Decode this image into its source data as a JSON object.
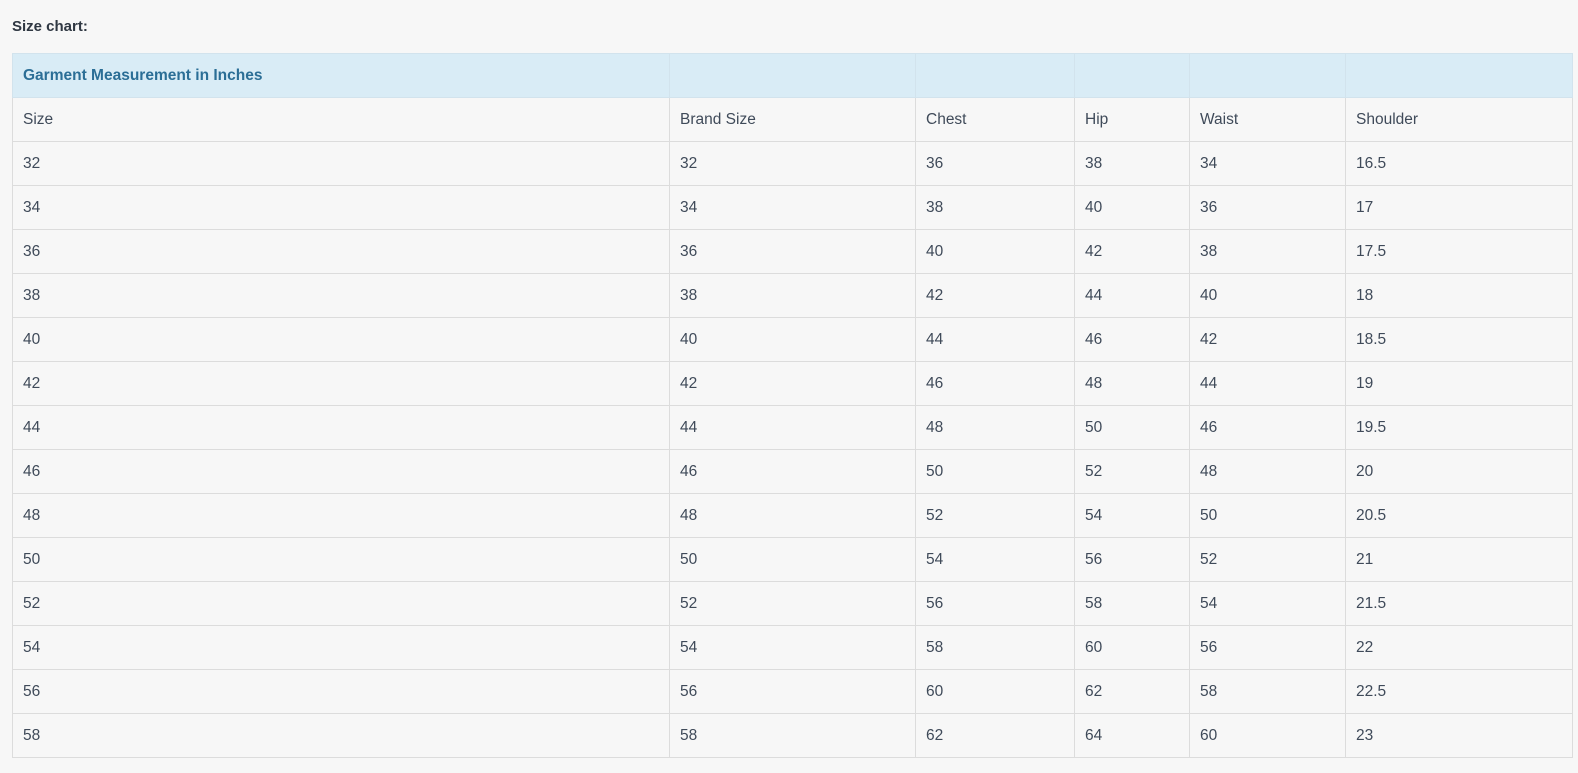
{
  "page": {
    "heading": "Size chart:"
  },
  "table": {
    "caption": "Garment Measurement in Inches",
    "headers": [
      "Size",
      "Brand Size",
      "Chest",
      "Hip",
      "Waist",
      "Shoulder"
    ],
    "rows": [
      [
        "32",
        "32",
        "36",
        "38",
        "34",
        "16.5"
      ],
      [
        "34",
        "34",
        "38",
        "40",
        "36",
        "17"
      ],
      [
        "36",
        "36",
        "40",
        "42",
        "38",
        "17.5"
      ],
      [
        "38",
        "38",
        "42",
        "44",
        "40",
        "18"
      ],
      [
        "40",
        "40",
        "44",
        "46",
        "42",
        "18.5"
      ],
      [
        "42",
        "42",
        "46",
        "48",
        "44",
        "19"
      ],
      [
        "44",
        "44",
        "48",
        "50",
        "46",
        "19.5"
      ],
      [
        "46",
        "46",
        "50",
        "52",
        "48",
        "20"
      ],
      [
        "48",
        "48",
        "52",
        "54",
        "50",
        "20.5"
      ],
      [
        "50",
        "50",
        "54",
        "56",
        "52",
        "21"
      ],
      [
        "52",
        "52",
        "56",
        "58",
        "54",
        "21.5"
      ],
      [
        "54",
        "54",
        "58",
        "60",
        "56",
        "22"
      ],
      [
        "56",
        "56",
        "60",
        "62",
        "58",
        "22.5"
      ],
      [
        "58",
        "58",
        "62",
        "64",
        "60",
        "23"
      ]
    ]
  },
  "colors": {
    "background": "#f7f7f7",
    "caption_background": "#d9ecf6",
    "caption_text": "#2b6e96",
    "text": "#3f4a59",
    "border": "#dcdcdc"
  }
}
